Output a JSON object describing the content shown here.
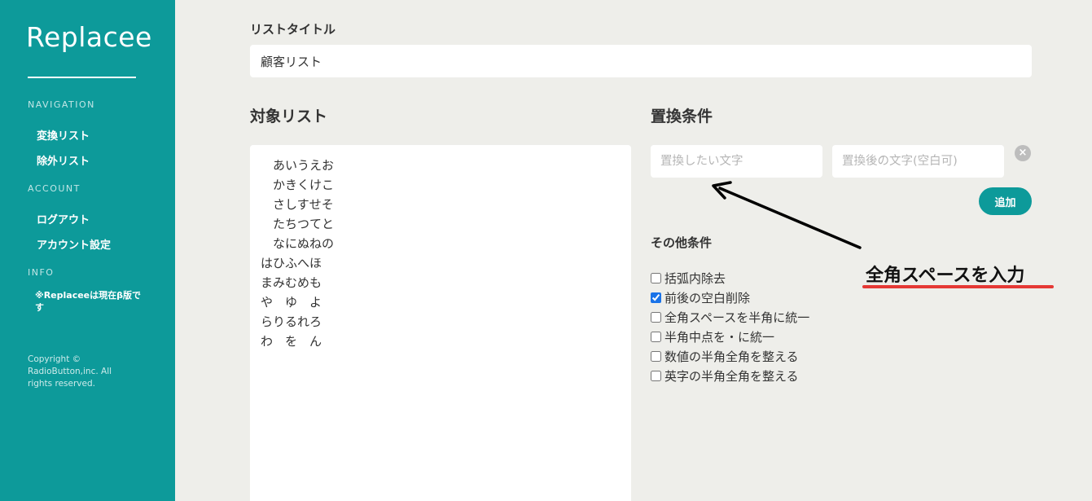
{
  "app": {
    "name": "Replacee"
  },
  "sidebar": {
    "navigation_heading": "NAVIGATION",
    "navigation_items": [
      {
        "label": "変換リスト"
      },
      {
        "label": "除外リスト"
      }
    ],
    "account_heading": "ACCOUNT",
    "account_items": [
      {
        "label": "ログアウト"
      },
      {
        "label": "アカウント設定"
      }
    ],
    "info_heading": "INFO",
    "info_note": "※Replaceeは現在β版です",
    "copyright": "Copyright © RadioButton,inc. All rights reserved."
  },
  "list_title": {
    "label": "リストタイトル",
    "value": "顧客リスト"
  },
  "target_list": {
    "label": "対象リスト",
    "lines": [
      "　あいうえお",
      "　かきくけこ",
      "　さしすせそ",
      "　たちつてと",
      "　なにぬねの",
      "はひふへほ",
      "まみむめも",
      "や　ゆ　よ",
      "らりるれろ",
      "わ　を　ん"
    ]
  },
  "replace": {
    "label": "置換条件",
    "from_placeholder": "置換したい文字",
    "to_placeholder": "置換後の文字(空白可)",
    "clear_symbol": "×",
    "add_button": "追加"
  },
  "other_conditions": {
    "label": "その他条件",
    "options": [
      {
        "label": "括弧内除去",
        "checked": false
      },
      {
        "label": "前後の空白削除",
        "checked": true
      },
      {
        "label": "全角スペースを半角に統一",
        "checked": false
      },
      {
        "label": "半角中点を・に統一",
        "checked": false
      },
      {
        "label": "数値の半角全角を整える",
        "checked": false
      },
      {
        "label": "英字の半角全角を整える",
        "checked": false
      }
    ]
  },
  "annotation": {
    "text": "全角スペースを入力",
    "underline_color": "#e53935"
  },
  "colors": {
    "accent": "#0d9a9a",
    "background": "#eeeeea"
  }
}
